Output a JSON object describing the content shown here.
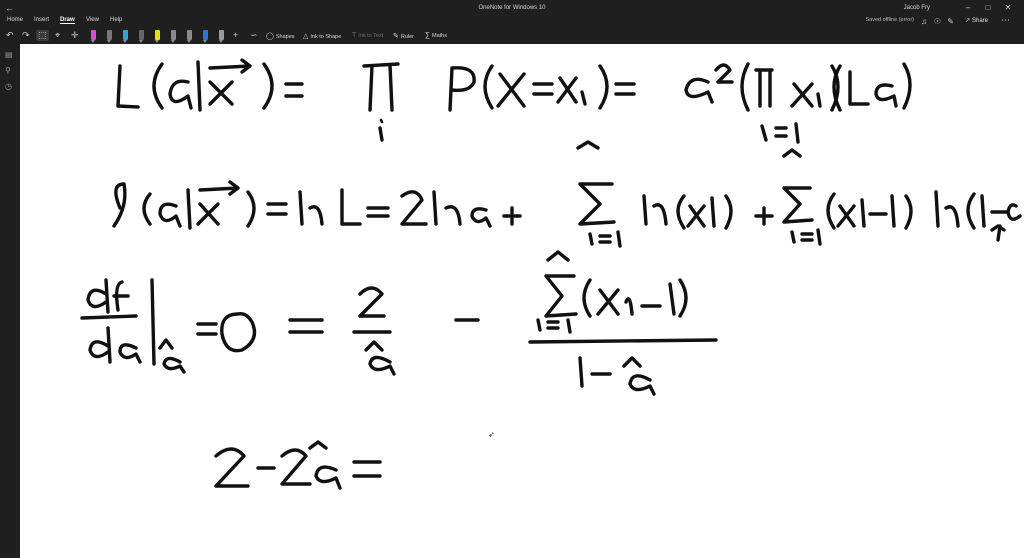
{
  "window": {
    "title": "OneNote for Windows 10",
    "user": "Jacob Fry",
    "back_icon": "back-arrow-icon",
    "controls": [
      "minimize-icon",
      "maximize-icon",
      "close-icon"
    ]
  },
  "menu": {
    "tabs": [
      "Home",
      "Insert",
      "Draw",
      "View",
      "Help"
    ],
    "active_tab": "Draw",
    "status": "Saved offline (error)",
    "share_label": "Share"
  },
  "toolbar": {
    "shapes_label": "Shapes",
    "ink_to_shape_label": "Ink to Shape",
    "ink_to_text_label": "Ink to Text",
    "ruler_label": "Ruler",
    "maths_label": "Maths",
    "pen_colors": [
      "#d64de0",
      "#777777",
      "#3aa0d8",
      "#666666",
      "#e5e01a",
      "#8a8a8a",
      "#8a8a8a",
      "#2c78d6",
      "#9a9a9a"
    ]
  }
}
